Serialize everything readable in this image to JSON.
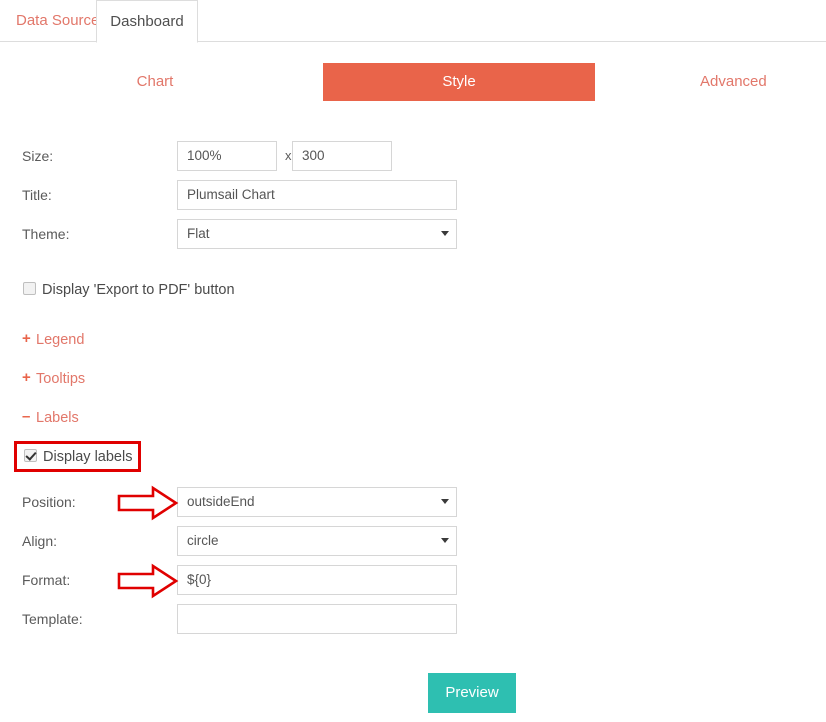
{
  "window": {
    "tabs": [
      {
        "label": "Data Source",
        "active": false
      },
      {
        "label": "Dashboard",
        "active": true
      }
    ]
  },
  "subnav": {
    "items": [
      {
        "label": "Chart",
        "active": false
      },
      {
        "label": "Style",
        "active": true
      },
      {
        "label": "Advanced",
        "active": false
      }
    ]
  },
  "form": {
    "size": {
      "label": "Size:",
      "width_value": "100%",
      "separator": "x",
      "height_value": "300"
    },
    "title": {
      "label": "Title:",
      "value": "Plumsail Chart"
    },
    "theme": {
      "label": "Theme:",
      "value": "Flat"
    },
    "export_pdf": {
      "label": "Display 'Export to PDF' button",
      "checked": false
    },
    "sections": [
      {
        "sign": "+",
        "label": "Legend",
        "expanded": false
      },
      {
        "sign": "+",
        "label": "Tooltips",
        "expanded": false
      },
      {
        "sign": "–",
        "label": "Labels",
        "expanded": true
      }
    ],
    "display_labels": {
      "label": "Display labels",
      "checked": true
    },
    "position": {
      "label": "Position:",
      "value": "outsideEnd"
    },
    "align": {
      "label": "Align:",
      "value": "circle"
    },
    "format": {
      "label": "Format:",
      "value": "${0}"
    },
    "template": {
      "label": "Template:",
      "value": ""
    }
  },
  "actions": {
    "preview_label": "Preview"
  },
  "colors": {
    "accent_orange": "#e9644a",
    "link_salmon": "#e2776a",
    "preview_teal": "#2ebfb1",
    "highlight_red": "#e00000",
    "border_gray": "#d6d6d6"
  }
}
